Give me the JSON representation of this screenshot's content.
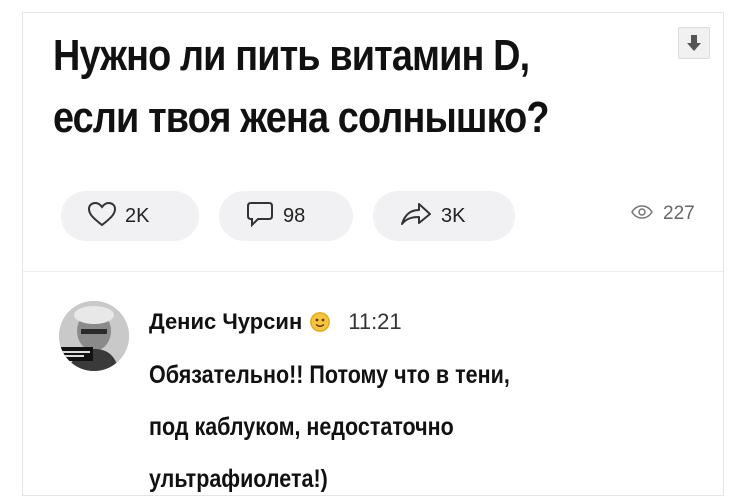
{
  "post": {
    "title_line1": "Нужно ли пить витамин D,",
    "title_line2": "если твоя жена солнышко?"
  },
  "actions": {
    "likes": "2K",
    "comments": "98",
    "shares": "3K",
    "views": "227"
  },
  "comment": {
    "author": "Денис Чурсин",
    "time": "11:21",
    "line1": "Обязательно!! Потому что в тени,",
    "line2": "под каблуком, недостаточно",
    "line3": "ультрафиолета!)"
  },
  "icons": {
    "download": "download-arrow-icon",
    "like": "heart-icon",
    "comment": "speech-bubble-icon",
    "share": "share-arrow-icon",
    "views": "eye-icon",
    "author_badge": "emoji-badge-icon"
  },
  "colors": {
    "pill_background": "#f1f1f3",
    "text": "#111111",
    "muted": "#666666",
    "emoji": "#f5c542"
  }
}
